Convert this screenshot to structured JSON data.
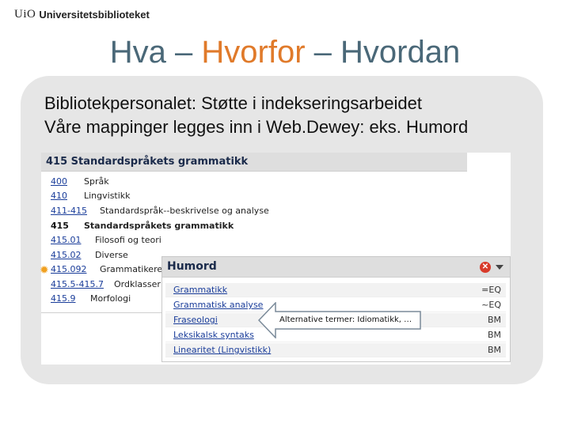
{
  "header": {
    "logo_mark": "UiO",
    "logo_name": "Universitetsbiblioteket"
  },
  "title": {
    "part1": "Hva – ",
    "part2": "Hvorfor",
    "part3": " – Hvordan"
  },
  "bullets": [
    "Bibliotekpersonalet: Støtte i indekseringsarbeidet",
    "Våre mappinger legges inn i Web.Dewey: eks. Humord"
  ],
  "dewey": {
    "header": "415 Standardspråkets grammatikk",
    "rows": [
      {
        "code": "400",
        "label": "Språk"
      },
      {
        "code": "410",
        "label": "Lingvistikk"
      },
      {
        "code": "411-415",
        "label": "Standardspråk--beskrivelse og analyse"
      },
      {
        "code": "415",
        "label": "Standardspråkets grammatikk"
      },
      {
        "code": "415.01",
        "label": "Filosofi og teori"
      },
      {
        "code": "415.02",
        "label": "Diverse"
      },
      {
        "code": "415.092",
        "label": "Grammatikere"
      },
      {
        "code": "415.5-415.7",
        "label": "Ordklasser"
      },
      {
        "code": "415.9",
        "label": "Morfologi"
      }
    ]
  },
  "humord": {
    "title": "Humord",
    "terms": [
      {
        "term": "Grammatikk",
        "relation": "=EQ"
      },
      {
        "term": "Grammatisk analyse",
        "relation": "~EQ"
      },
      {
        "term": "Fraseologi",
        "relation": "BM"
      },
      {
        "term": "Leksikalsk syntaks",
        "relation": "BM"
      },
      {
        "term": "Linearitet (Lingvistikk)",
        "relation": "BM"
      }
    ]
  },
  "callout": {
    "text": "Alternative termer: Idiomatikk, …"
  },
  "colors": {
    "title": "#4a6878",
    "accent": "#e07a2a",
    "link": "#1a3d9a",
    "panel": "#e6e6e6"
  },
  "icons": {
    "close": "close-icon",
    "menu": "chevron-down-icon",
    "star": "star-icon"
  }
}
